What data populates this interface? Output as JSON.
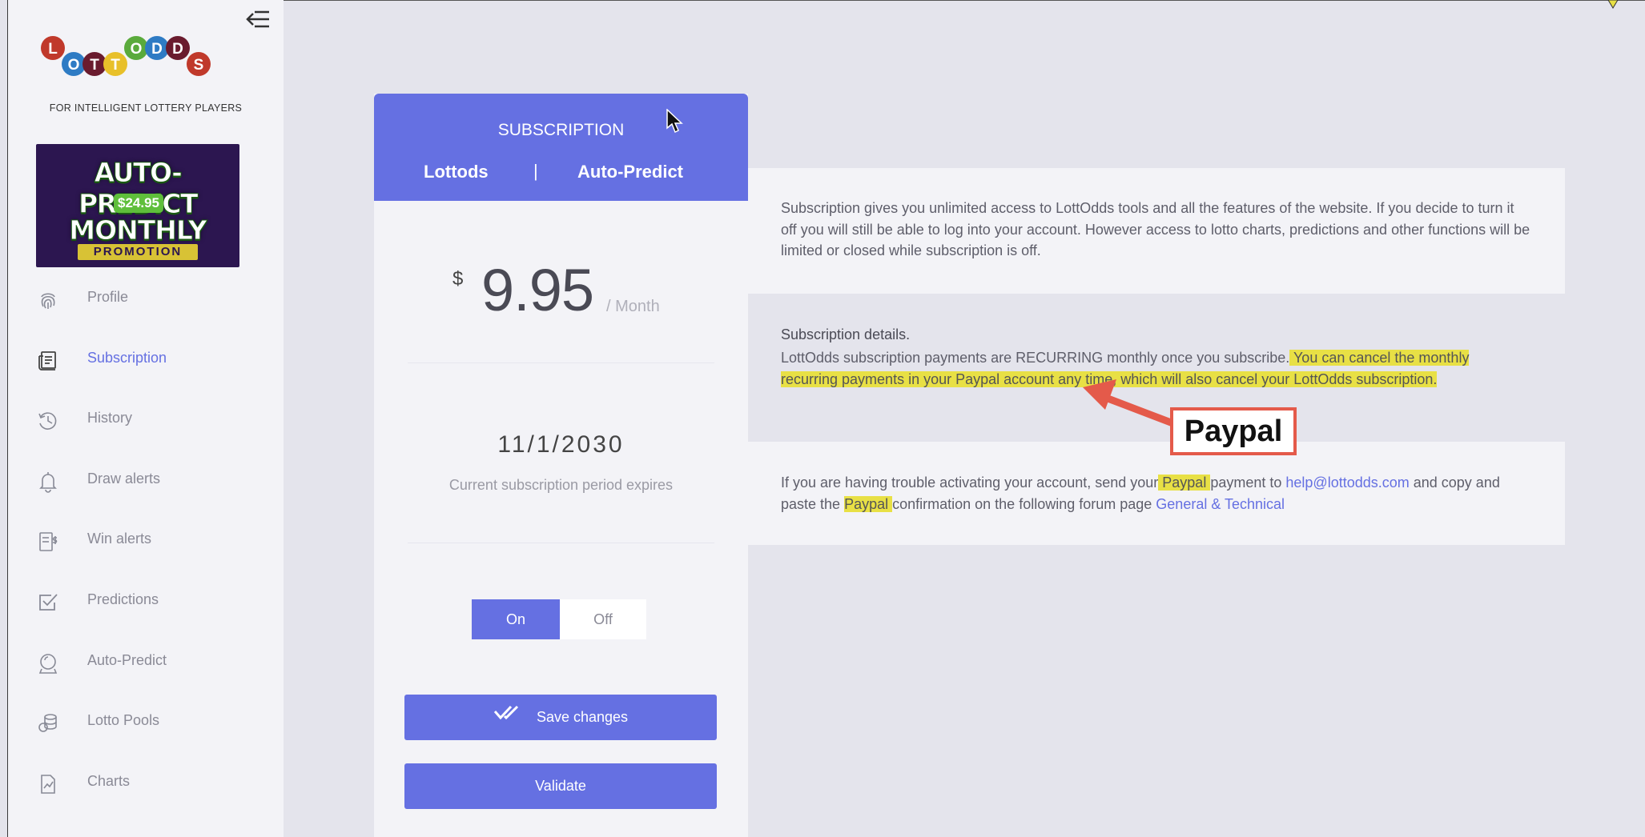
{
  "sidebar": {
    "logo_text": "LOTTODDS",
    "tagline": "FOR INTELLIGENT LOTTERY PLAYERS",
    "promo": {
      "line1": "AUTO-PREDICT",
      "price": "$24.95",
      "line2": "MONTHLY",
      "line3": "PROMOTION"
    },
    "items": [
      {
        "label": "Profile",
        "icon": "fingerprint-icon"
      },
      {
        "label": "Subscription",
        "icon": "receipt-icon",
        "active": true
      },
      {
        "label": "History",
        "icon": "history-icon"
      },
      {
        "label": "Draw alerts",
        "icon": "bell-icon"
      },
      {
        "label": "Win alerts",
        "icon": "dollar-document-icon"
      },
      {
        "label": "Predictions",
        "icon": "checkbox-icon"
      },
      {
        "label": "Auto-Predict",
        "icon": "crystal-ball-icon"
      },
      {
        "label": "Lotto Pools",
        "icon": "coins-icon"
      },
      {
        "label": "Charts",
        "icon": "chart-document-icon"
      }
    ]
  },
  "card": {
    "title": "SUBSCRIPTION",
    "tab_lottods": "Lottods",
    "tab_separator": "|",
    "tab_autopredict": "Auto-Predict",
    "currency": "$",
    "price": "9.95",
    "period": "/ Month",
    "expiry_date": "11/1/2030",
    "expiry_label": "Current subscription period expires",
    "toggle_on": "On",
    "toggle_off": "Off",
    "toggle_state": "On",
    "save_label": "Save changes",
    "validate_label": "Validate"
  },
  "info": {
    "intro": "Subscription gives you unlimited access to LottOdds tools and all the features of the website. If you decide to turn it off you will still be able to log into your account. However access to lotto charts, predictions and other functions will be limited or closed while subscription is off.",
    "details_heading": "Subscription details.",
    "details_plain": "LottOdds subscription payments are RECURRING monthly once you subscribe.",
    "details_highlight": " You can cancel the monthly recurring payments in your Paypal account any time, which will also cancel your LottOdds subscription. ",
    "trouble_1": "If you are having trouble activating your account, send your",
    "trouble_paypal_1": " Paypal ",
    "trouble_2": "payment to ",
    "email_link": "help@lottodds.com",
    "trouble_3": " and copy and paste the ",
    "trouble_paypal_2": "Paypal ",
    "trouble_4": "confirmation on the following forum page ",
    "forum_link": "General & Technical"
  },
  "annotation": {
    "label": "Paypal",
    "color": "#e45a4a"
  },
  "colors": {
    "accent": "#6570e2",
    "highlight": "#e8e045",
    "background": "#e4e4ec"
  }
}
